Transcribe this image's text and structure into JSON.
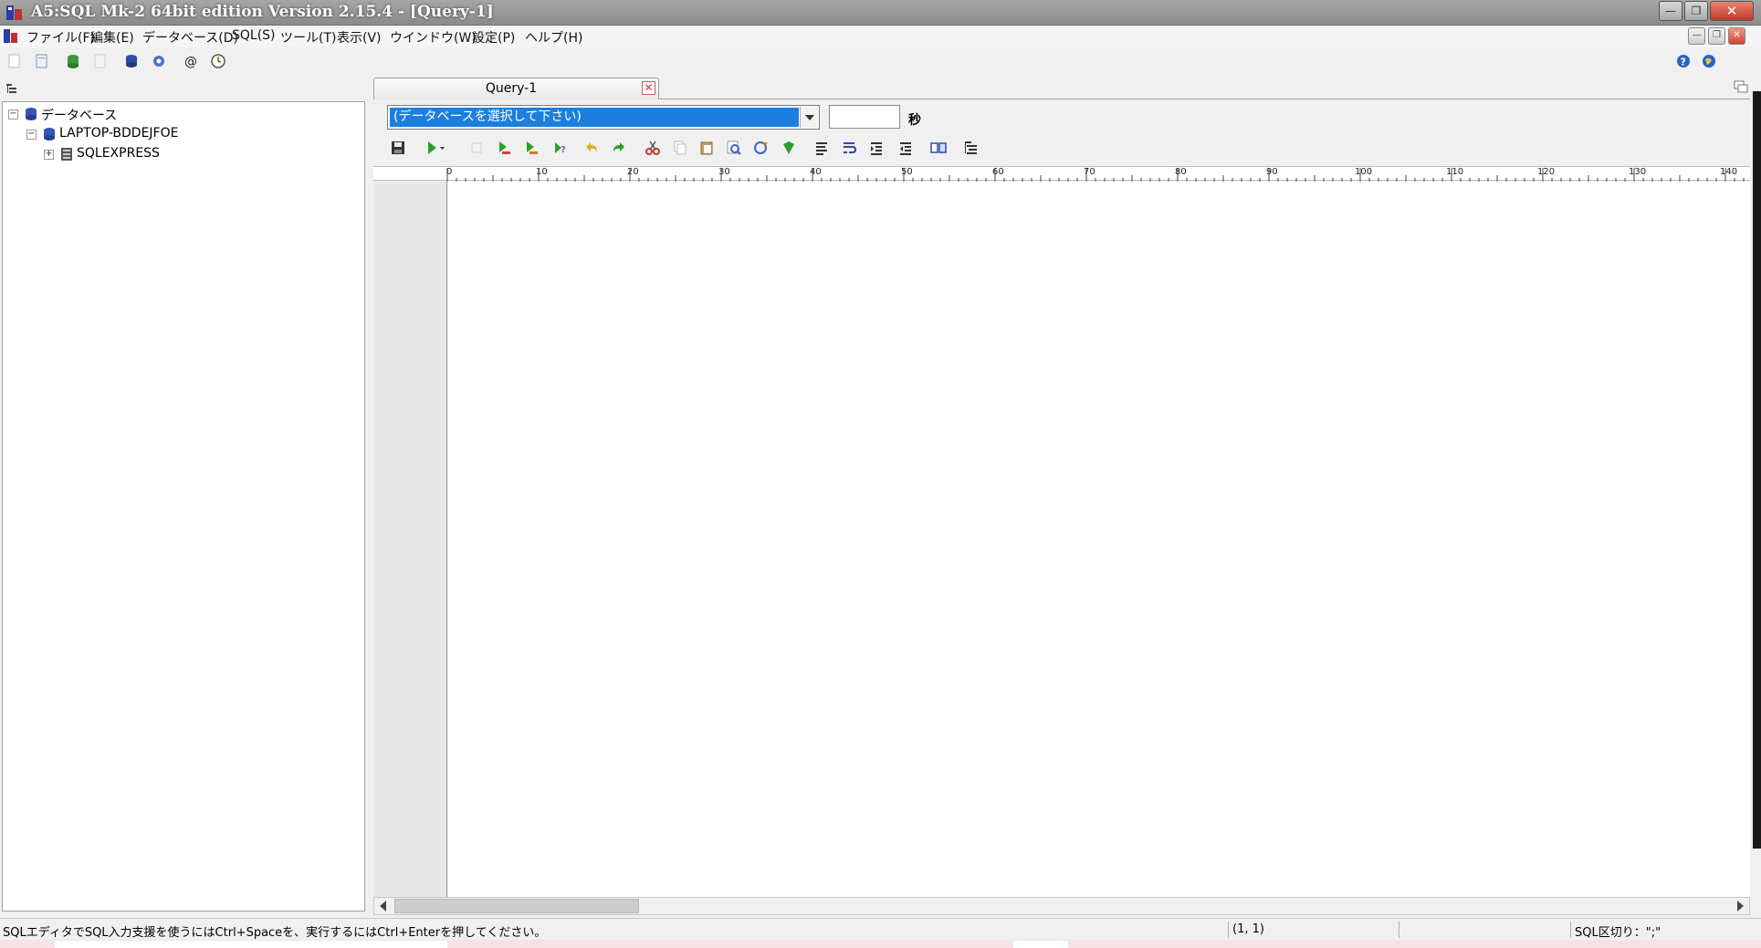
{
  "window": {
    "title": "A5:SQL Mk-2 64bit edition Version 2.15.4 - [Query-1]",
    "minimize_label": "—",
    "restore_label": "❐",
    "close_label": "✕"
  },
  "menu": {
    "items": [
      "ファイル(F)",
      "編集(E)",
      "データベース(D)",
      "SQL(S)",
      "ツール(T)",
      "表示(V)",
      "ウインドウ(W)",
      "設定(P)",
      "ヘルプ(H)"
    ]
  },
  "toolbar": {
    "icons": [
      "new-icon",
      "open-icon",
      "connect-icon",
      "disconnect-icon",
      "database-icon",
      "settings-gear-icon",
      "at-icon",
      "clock-icon"
    ],
    "right_icons": [
      "help-icon",
      "web-icon"
    ]
  },
  "tree": {
    "items": [
      {
        "label": "データベース",
        "expander": "−",
        "icon": "databases-icon"
      },
      {
        "label": "LAPTOP-BDDEJFOE",
        "expander": "−",
        "icon": "server-icon"
      },
      {
        "label": "SQLEXPRESS",
        "expander": "+",
        "icon": "instance-icon"
      }
    ]
  },
  "document": {
    "tab_label": "Query-1",
    "tab_close": "✕",
    "db_select": "(データベースを選択して下さい)",
    "timeout_value": "",
    "seconds_label": "秒"
  },
  "editor_toolbar": {
    "icons": [
      "save-icon",
      "run-icon",
      "stop-icon",
      "run-all-icon",
      "run-current-icon",
      "explain-icon",
      "undo-icon",
      "redo-icon",
      "cut-icon",
      "copy-icon",
      "paste-icon",
      "find-icon",
      "replace-icon",
      "format-icon",
      "align-left-icon",
      "wrap-icon",
      "indent-icon",
      "outdent-icon",
      "compare-icon",
      "outline-icon"
    ]
  },
  "ruler": {
    "labels": [
      "0",
      "10",
      "20",
      "30",
      "40",
      "50",
      "60",
      "70",
      "80",
      "90",
      "100",
      "110",
      "120",
      "130",
      "140"
    ]
  },
  "status": {
    "hint": "SQLエディタでSQL入力支援を使うにはCtrl+Spaceを、実行するにはCtrl+Enterを押してください。",
    "position": "(1, 1)",
    "delimiter": "SQL区切り：\";\""
  },
  "colors": {
    "selection": "#1b7fe0",
    "close_red": "#c4372a",
    "title_gray": "#8c8c8c"
  }
}
